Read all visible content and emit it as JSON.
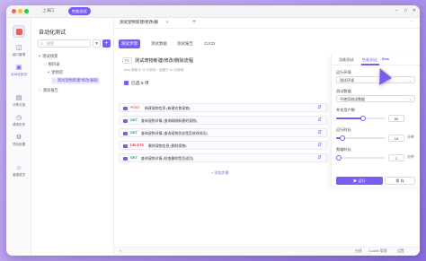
{
  "window": {
    "title_left": "上海口",
    "active_pill": "性能测试",
    "controls": [
      "−",
      "□",
      "✕"
    ]
  },
  "iconbar": {
    "items": [
      {
        "label": "接口管理",
        "icon": "api-icon"
      },
      {
        "label": "自动化测试",
        "icon": "automation-icon"
      },
      {
        "label": "分享文档",
        "icon": "doc-icon"
      },
      {
        "label": "请求历史",
        "icon": "history-icon"
      },
      {
        "label": "项目设置",
        "icon": "settings-icon"
      },
      {
        "label": "邀请成员",
        "icon": "invite-icon"
      }
    ]
  },
  "tree": {
    "title": "自动化测试",
    "search_placeholder": "搜索",
    "nodes": [
      {
        "label": "测试场景",
        "icon": "▾"
      },
      {
        "label": "根目录",
        "icon": "□"
      },
      {
        "label": "宠物店",
        "icon": "▾"
      },
      {
        "label": "测试宠物新建/修改/删除",
        "icon": "□"
      },
      {
        "label": "测试报告",
        "icon": "□"
      }
    ]
  },
  "main": {
    "doc_tab": "测试宠物新建/修改/删",
    "subtabs": [
      "测试步骤",
      "测试数据",
      "测试报告",
      "CI/CD"
    ],
    "header_badge": "P2",
    "header_title": "测试宠物新建/修改/删除流程",
    "meta": "Amy 更新于 10 分钟前 · 创建于 10 分钟前",
    "total": "已选 5 项",
    "steps": [
      {
        "method": "POST",
        "color": "#e8673c",
        "text": "新建宠物信息 (新建在售宠物)"
      },
      {
        "method": "GET",
        "color": "#21a366",
        "text": "查询宠物详情 (查询刚刚新建的宠物)"
      },
      {
        "method": "GET",
        "color": "#21a366",
        "text": "查询宠物详情 (查询宠物状态是否修改成功)"
      },
      {
        "method": "DELETE",
        "color": "#e03a3a",
        "text": "删除宠物信息 (删除宠物)"
      },
      {
        "method": "GET",
        "color": "#21a366",
        "text": "查询宠物详情 (检查删除是否成功)"
      }
    ],
    "add_step": "+ 添加步骤",
    "footer": {
      "collapse": "«",
      "online": "在线",
      "cookie": "Cookie 管理",
      "settings": "设置"
    }
  },
  "panel": {
    "tabs": [
      "功能测试",
      "性能测试"
    ],
    "beta": "Beta",
    "env_label": "运行环境",
    "env_value": "测试环境",
    "data_label": "测试数据",
    "data_value": "不使用测试数据",
    "vu_label": "并发用户数",
    "vu_value": "50",
    "vu_fraction": 0.55,
    "duration_label": "运行时长",
    "duration_value": "10",
    "duration_unit": "分钟",
    "duration_fraction": 0.12,
    "ramp_label": "爬坡时长",
    "ramp_value": "1",
    "ramp_unit": "分钟",
    "ramp_fraction": 0.05,
    "run": "▶ 运行",
    "save": "保 存"
  },
  "colors": {
    "accent": "#7b5cf0",
    "post": "#e8673c",
    "get": "#21a366",
    "delete": "#e03a3a"
  }
}
